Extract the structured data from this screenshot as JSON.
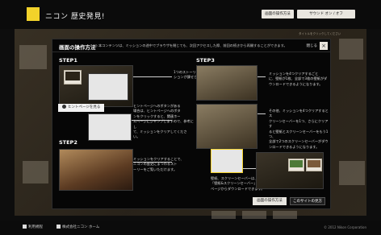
{
  "header": {
    "site_title": "ニコン 歴史発見!",
    "help_button": "画面の操作方法",
    "sound_toggle": "サウンド オン / オフ"
  },
  "background": {
    "note": "タイトルをクリックしてください"
  },
  "modal": {
    "title": "画面の操作方法",
    "description": "◎ 本コンテンツは、ミッションの途中でブラウザを閉じても、次回アクセスした際、前回の続きから再開することができます。",
    "close_label": "閉じる",
    "close_icon": "×",
    "steps": [
      {
        "label": "STEP1",
        "text": [
          "1つのストーリーにつき、1つのミッ",
          "ションが課せられます。"
        ]
      },
      {
        "label": "STEP2",
        "text": [
          "ミッションをクリアすることで、",
          "ニコンの歴史にまつわるスト",
          "ーリーをご覧いただけます。"
        ]
      },
      {
        "label": "STEP3",
        "text_a": [
          "ミッションを4つクリアするごと",
          "に、壁紙が1枚、全部で3枚の壁紙がダ",
          "ウンロードできるようになります。"
        ],
        "text_b": [
          "その他、ミッションを4つクリアするとス",
          "クリーンセーバーを1つ、さらにクリアす",
          "ると壁紙とスクリーンセーバーをもう1つ、",
          "全部で2つのスクリーンセーバーがダウ",
          "ンロードできるようになります。"
        ],
        "text_c": [
          "壁紙、スクリーンセーバーは、",
          "「壁紙&スクリーンセーバー」",
          "ページからダウンロードできます。"
        ]
      }
    ],
    "hint_text": [
      "ヒントページへのボタンがある",
      "場合は、ヒントページへのボタ",
      "ンをクリックすると、関連ホー",
      "ムページにジャンプしますので、参考にし",
      "て、ミッションをクリアしてくださ",
      "い。"
    ],
    "hint_button": "ヒントページを見る",
    "footer_buttons": {
      "help": "画面の操作方法",
      "about": "このサイトの見方"
    }
  },
  "footer": {
    "link1": "利用規程",
    "link2": "株式会社ニコン ホーム",
    "copyright": "© 2012 Nikon Corporation"
  }
}
